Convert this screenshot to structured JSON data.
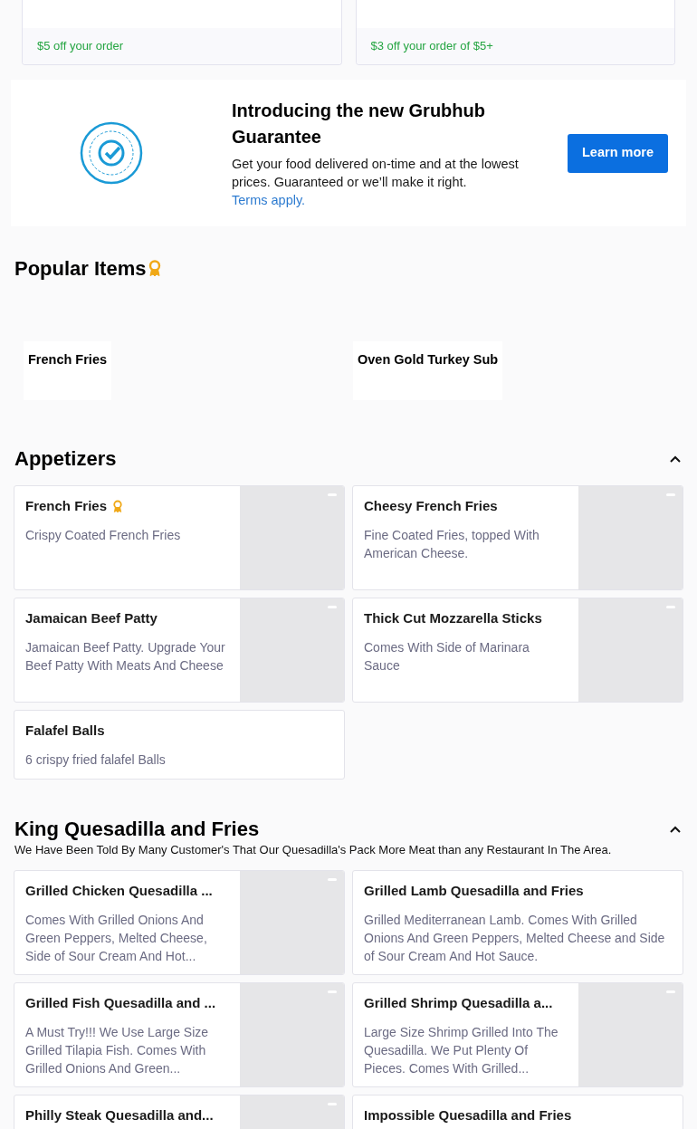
{
  "offers": [
    {
      "text": "$5 off your order"
    },
    {
      "text": "$3 off your order of $5+"
    }
  ],
  "guarantee": {
    "title": "Introducing the new Grubhub Guarantee",
    "body": "Get your food delivered on-time and at the lowest prices. Guaranteed or we’ll make it right.",
    "link": "Terms apply.",
    "button": "Learn more"
  },
  "popular": {
    "title": "Popular Items",
    "items": [
      {
        "name": "French Fries"
      },
      {
        "name": "Oven Gold Turkey Sub"
      }
    ]
  },
  "sections": [
    {
      "title": "Appetizers",
      "expanded": true,
      "items": [
        {
          "name": "French Fries",
          "popular": true,
          "description": "Crispy Coated French Fries",
          "has_image": true
        },
        {
          "name": "Cheesy French Fries",
          "popular": false,
          "description": "Fine Coated Fries, topped With American Cheese.",
          "has_image": true
        },
        {
          "name": "Jamaican Beef Patty",
          "popular": false,
          "description": "Jamaican Beef Patty. Upgrade Your Beef Patty With Meats And Cheese",
          "has_image": true
        },
        {
          "name": "Thick Cut Mozzarella Sticks",
          "popular": false,
          "description": "Comes With Side of Marinara Sauce",
          "has_image": true
        },
        {
          "name": "Falafel Balls",
          "popular": false,
          "description": "6 crispy fried falafel Balls",
          "has_image": false
        }
      ]
    },
    {
      "title": "King Quesadilla and Fries",
      "expanded": true,
      "description": "We Have Been Told By Many Customer's That Our Quesadilla's Pack More Meat than any Restaurant In The Area.",
      "items": [
        {
          "name": "Grilled Chicken Quesadilla ...",
          "popular": false,
          "description": "Comes With Grilled Onions And Green Peppers, Melted Cheese, Side of Sour Cream And Hot...",
          "has_image": true
        },
        {
          "name": "Grilled Lamb Quesadilla and Fries",
          "popular": false,
          "description": "Grilled Mediterranean Lamb. Comes With Grilled Onions And Green Peppers, Melted Cheese and Side of Sour Cream And Hot Sauce.",
          "has_image": false
        },
        {
          "name": "Grilled Fish Quesadilla and ...",
          "popular": false,
          "description": "A Must Try!!! We Use Large Size Grilled Tilapia Fish. Comes With Grilled Onions And Green...",
          "has_image": true
        },
        {
          "name": "Grilled Shrimp Quesadilla a...",
          "popular": false,
          "description": "Large Size Shrimp Grilled Into The Quesadilla. We Put Plenty Of Pieces. Comes With Grilled...",
          "has_image": true
        },
        {
          "name": "Philly Steak Quesadilla and...",
          "popular": false,
          "has_image": true
        },
        {
          "name": "Impossible Quesadilla and Fries",
          "popular": false,
          "has_image": false
        }
      ]
    }
  ]
}
